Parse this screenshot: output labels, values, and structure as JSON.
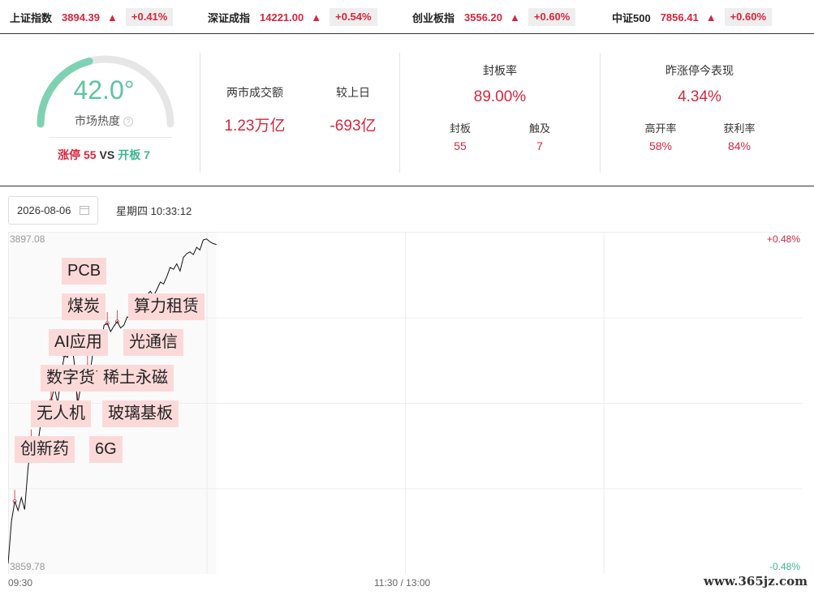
{
  "indices": [
    {
      "name": "上证指数",
      "value": "3894.39",
      "arrow": "▲",
      "change": "+0.41%"
    },
    {
      "name": "深证成指",
      "value": "14221.00",
      "arrow": "▲",
      "change": "+0.54%"
    },
    {
      "name": "创业板指",
      "value": "3556.20",
      "arrow": "▲",
      "change": "+0.60%"
    },
    {
      "name": "中证500",
      "value": "7856.41",
      "arrow": "▲",
      "change": "+0.60%"
    }
  ],
  "heat": {
    "value": "42.0°",
    "label": "市场热度",
    "info_icon": "?",
    "level": 0.42,
    "limit_up_label": "涨停 55",
    "vs": "VS",
    "open_board_label": "开板 7"
  },
  "turnover": {
    "label": "两市成交额",
    "value": "1.23万亿",
    "compare_label": "较上日",
    "compare_value": "-693亿"
  },
  "seal": {
    "label": "封板率",
    "value": "89.00%",
    "sub": [
      {
        "label": "封板",
        "value": "55"
      },
      {
        "label": "触及",
        "value": "7"
      }
    ]
  },
  "yesterday": {
    "label": "昨涨停今表现",
    "value": "4.34%",
    "sub": [
      {
        "label": "高开率",
        "value": "58%"
      },
      {
        "label": "获利率",
        "value": "84%"
      }
    ]
  },
  "date_picker": {
    "value": "2026-08-06",
    "icon": "calendar-icon"
  },
  "datetime_text": "星期四 10:33:12",
  "chart_data": {
    "type": "line",
    "y_top_label": "3897.08",
    "y_bottom_label": "3859.78",
    "pct_top_label": "+0.48%",
    "pct_bottom_label": "-0.48%",
    "ylim": [
      3859.78,
      3897.08
    ],
    "x_labels": [
      "09:30",
      "11:30 / 13:00"
    ],
    "x_range_minutes": [
      0,
      240
    ],
    "grid": true,
    "series": [
      {
        "x": [
          0,
          1,
          2,
          3,
          4,
          5,
          6,
          7,
          8,
          9,
          10,
          11,
          12,
          13,
          14,
          15,
          16,
          17,
          18,
          19,
          20,
          21,
          22,
          23,
          24,
          25,
          26,
          27,
          28,
          29,
          30,
          31,
          32,
          33,
          34,
          35,
          36,
          37,
          38,
          39,
          40,
          41,
          42,
          43,
          44,
          45,
          46,
          47,
          48,
          49,
          50,
          51,
          52,
          53,
          54,
          55,
          56,
          57,
          58,
          59,
          60,
          61,
          62,
          63
        ],
        "values": [
          3860.9,
          3865.5,
          3867.7,
          3866.7,
          3868.1,
          3866.8,
          3871.3,
          3874.3,
          3874.4,
          3874.0,
          3876.6,
          3878.2,
          3876.0,
          3878.7,
          3880.1,
          3878.4,
          3881.4,
          3883.6,
          3883.4,
          3885.7,
          3882.8,
          3878.2,
          3880.3,
          3880.9,
          3882.4,
          3882.3,
          3884.9,
          3885.4,
          3884.7,
          3886.9,
          3887.1,
          3886.2,
          3886.8,
          3887.3,
          3886.6,
          3886.9,
          3887.8,
          3887.7,
          3889.1,
          3887.9,
          3888.6,
          3888.8,
          3890.2,
          3890.6,
          3890.1,
          3890.8,
          3891.6,
          3891.4,
          3892.2,
          3893.2,
          3893.0,
          3893.6,
          3892.8,
          3894.3,
          3894.7,
          3894.9,
          3894.6,
          3895.4,
          3895.1,
          3896.2,
          3896.3,
          3896.0,
          3895.8,
          3895.7
        ]
      }
    ],
    "tags": [
      {
        "label": "PCB",
        "x": 17,
        "value": 3883.6
      },
      {
        "label": "煤炭",
        "x": 17,
        "value": 3883.6
      },
      {
        "label": "算力租赁",
        "x": 37,
        "value": 3887.7
      },
      {
        "label": "AI应用",
        "x": 13,
        "value": 3878.7
      },
      {
        "label": "光通信",
        "x": 33,
        "value": 3887.3
      },
      {
        "label": "数字货币",
        "x": 10,
        "value": 3876.6
      },
      {
        "label": "稀土永磁",
        "x": 30,
        "value": 3887.1
      },
      {
        "label": "无人机",
        "x": 7,
        "value": 3874.3
      },
      {
        "label": "玻璃基板",
        "x": 24,
        "value": 3882.4
      },
      {
        "label": "创新药",
        "x": 2,
        "value": 3867.7
      },
      {
        "label": "6G",
        "x": 21,
        "value": 3878.2
      }
    ]
  },
  "watermark": "www.365jz.com"
}
